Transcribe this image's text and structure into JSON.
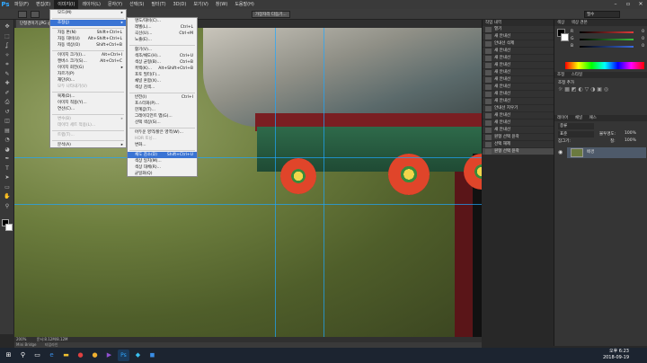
{
  "menubar": {
    "logo": "Ps",
    "items": [
      "파일(F)",
      "편집(E)",
      "이미지(I)",
      "레이어(L)",
      "문자(Y)",
      "선택(S)",
      "필터(T)",
      "3D(D)",
      "보기(V)",
      "창(W)",
      "도움말(H)"
    ],
    "active_index": 2,
    "win_controls": [
      "–",
      "▫",
      "✕"
    ]
  },
  "optbar": {
    "btn1": "가장자리 다듬기...",
    "workspace": "필수"
  },
  "doc_tab": "단청경이기.JPG @ 200%(RGB/8)",
  "status": {
    "zoom": "200%",
    "doc": "문서:8.12M/8.12M"
  },
  "mini_bridge": [
    "Mini Bridge",
    "타임라인"
  ],
  "image_menu": {
    "items": [
      {
        "label": "모드(M)",
        "sc": "",
        "arrow": true
      },
      {
        "sep": true
      },
      {
        "label": "조정(J)",
        "sc": "",
        "arrow": true,
        "hl": true
      },
      {
        "sep": true
      },
      {
        "label": "자동 톤(N)",
        "sc": "Shift+Ctrl+L"
      },
      {
        "label": "자동 대비(U)",
        "sc": "Alt+Shift+Ctrl+L"
      },
      {
        "label": "자동 색상(O)",
        "sc": "Shift+Ctrl+B"
      },
      {
        "sep": true
      },
      {
        "label": "이미지 크기(I)...",
        "sc": "Alt+Ctrl+I"
      },
      {
        "label": "캔버스 크기(S)...",
        "sc": "Alt+Ctrl+C"
      },
      {
        "label": "이미지 회전(G)",
        "sc": "",
        "arrow": true
      },
      {
        "label": "자르기(P)",
        "sc": ""
      },
      {
        "label": "재단(R)...",
        "sc": ""
      },
      {
        "label": "모두 나타내기(V)",
        "sc": "",
        "dis": true
      },
      {
        "sep": true
      },
      {
        "label": "복제(D)...",
        "sc": ""
      },
      {
        "label": "이미지 적용(Y)...",
        "sc": ""
      },
      {
        "label": "연산(C)...",
        "sc": ""
      },
      {
        "sep": true
      },
      {
        "label": "변수(B)",
        "sc": "",
        "arrow": true,
        "dis": true
      },
      {
        "label": "데이터 세트 적용(L)...",
        "sc": "",
        "dis": true
      },
      {
        "sep": true
      },
      {
        "label": "트랩(T)...",
        "sc": "",
        "dis": true
      },
      {
        "sep": true
      },
      {
        "label": "분석(A)",
        "sc": "",
        "arrow": true
      }
    ]
  },
  "adjust_menu": {
    "items": [
      {
        "label": "명도/대비(C)...",
        "sc": ""
      },
      {
        "label": "레벨(L)...",
        "sc": "Ctrl+L"
      },
      {
        "label": "곡선(U)...",
        "sc": "Ctrl+M"
      },
      {
        "label": "노출(E)...",
        "sc": ""
      },
      {
        "sep": true
      },
      {
        "label": "활기(V)...",
        "sc": ""
      },
      {
        "label": "색조/채도(H)...",
        "sc": "Ctrl+U"
      },
      {
        "label": "색상 균형(B)...",
        "sc": "Ctrl+B"
      },
      {
        "label": "흑백(K)...",
        "sc": "Alt+Shift+Ctrl+B"
      },
      {
        "label": "포토 필터(F)...",
        "sc": ""
      },
      {
        "label": "채널 혼합(X)...",
        "sc": ""
      },
      {
        "label": "색상 검색...",
        "sc": ""
      },
      {
        "sep": true
      },
      {
        "label": "반전(I)",
        "sc": "Ctrl+I"
      },
      {
        "label": "포스터화(P)...",
        "sc": ""
      },
      {
        "label": "한계값(T)...",
        "sc": ""
      },
      {
        "label": "그레이디언트 맵(G)...",
        "sc": ""
      },
      {
        "label": "선택 색상(S)...",
        "sc": ""
      },
      {
        "sep": true
      },
      {
        "label": "어두운 영역/밝은 영역(W)...",
        "sc": ""
      },
      {
        "label": "HDR 토닝...",
        "sc": "",
        "dis": true
      },
      {
        "label": "변화...",
        "sc": ""
      },
      {
        "sep": true
      },
      {
        "label": "채도 감소(D)",
        "sc": "Shift+Ctrl+U",
        "hl": true
      },
      {
        "label": "색상 일치(M)...",
        "sc": ""
      },
      {
        "label": "색상 대체(R)...",
        "sc": ""
      },
      {
        "label": "균일화(Q)",
        "sc": ""
      }
    ]
  },
  "history": {
    "tabs": "작업 내역",
    "items": [
      "열기",
      "새 안내선",
      "안내선 삭제",
      "새 안내선",
      "새 안내선",
      "새 안내선",
      "새 안내선",
      "새 안내선",
      "새 안내선",
      "새 안내선",
      "새 안내선",
      "안내선 지우기",
      "새 안내선",
      "새 안내선",
      "새 안내선",
      "원형 선택 윤곽",
      "선택 해제",
      "원형 선택 윤곽"
    ],
    "selected_index": 17
  },
  "color_panel": {
    "tabs": [
      "색상",
      "색상 견본"
    ],
    "rows": [
      {
        "lab": "R",
        "val": "0",
        "color": "#e03a3a"
      },
      {
        "lab": "G",
        "val": "0",
        "color": "#3ac03a"
      },
      {
        "lab": "B",
        "val": "0",
        "color": "#3a6ae0"
      }
    ]
  },
  "adjust_panel": {
    "tabs": [
      "조정",
      "스타일"
    ],
    "label": "조정 추가"
  },
  "layers_panel": {
    "tabs": [
      "레이어",
      "채널",
      "패스"
    ],
    "kind": "종류",
    "blend": "표준",
    "opacity_label": "불투명도:",
    "opacity": "100%",
    "lock_label": "잠그기:",
    "fill_label": "칠:",
    "fill": "100%",
    "layer_name": "배경"
  },
  "taskbar": {
    "time": "오후 6:23",
    "date": "2018-09-19"
  }
}
